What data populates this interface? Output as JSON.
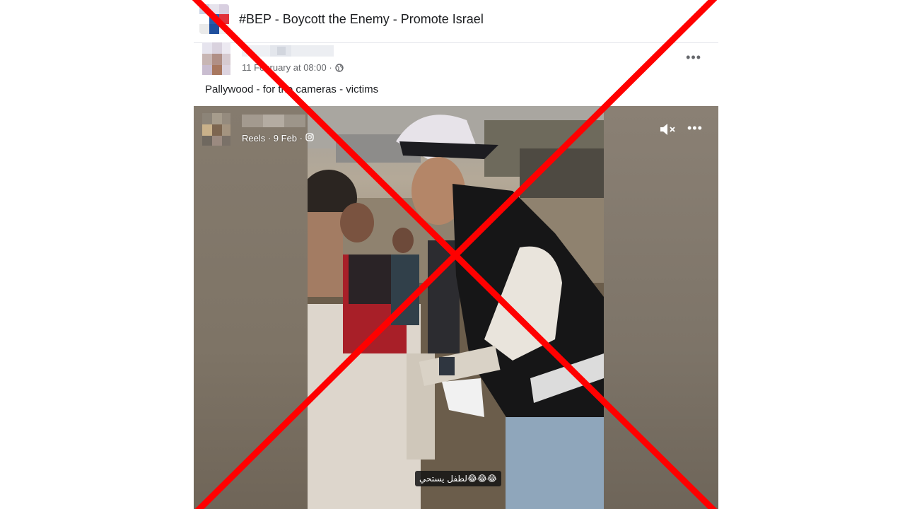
{
  "group": {
    "title": "#BEP - Boycott the Enemy - Promote Israel",
    "avatar_icon": "group-collage-avatar"
  },
  "post": {
    "timestamp": "11 February at 08:00 ·",
    "audience_icon": "globe-icon",
    "text": "Pallywood - for the cameras - victims",
    "more_icon": "more-options-icon",
    "more_label": "•••"
  },
  "reel": {
    "meta": "Reels · 9 Feb ·",
    "source_icon": "instagram-icon",
    "mute_icon": "muted-speaker-icon",
    "more_label": "•••",
    "caption": "لطفل يستحي😂😂😂"
  },
  "overlay": {
    "mark": "red-x-cross",
    "color": "#ff0000"
  }
}
